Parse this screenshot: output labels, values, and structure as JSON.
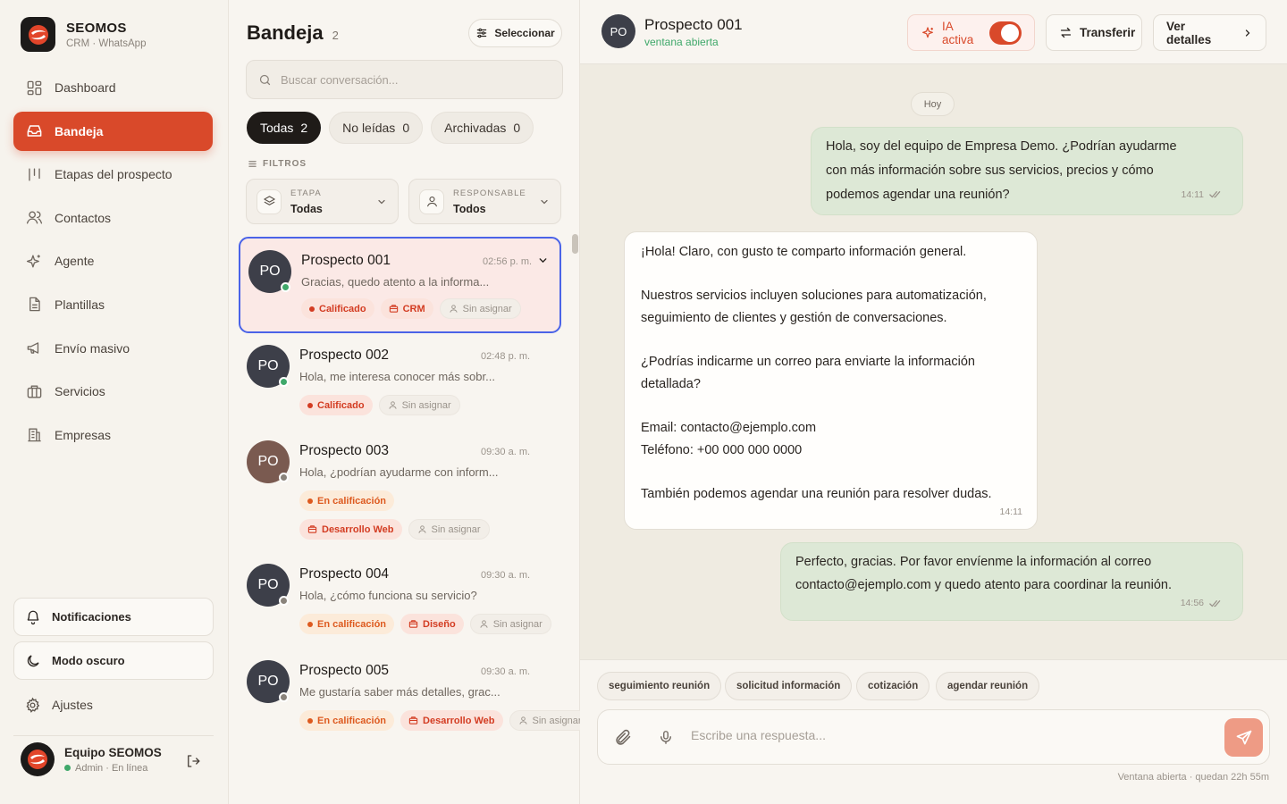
{
  "brand": {
    "name": "SEOMOS",
    "subtitle": "CRM · WhatsApp"
  },
  "nav": [
    {
      "label": "Dashboard",
      "icon": "dashboard-icon",
      "active": false
    },
    {
      "label": "Bandeja",
      "icon": "inbox-icon",
      "active": true
    },
    {
      "label": "Etapas del prospecto",
      "icon": "stages-icon",
      "active": false
    },
    {
      "label": "Contactos",
      "icon": "contacts-icon",
      "active": false
    },
    {
      "label": "Agente",
      "icon": "sparkle-icon",
      "active": false
    },
    {
      "label": "Plantillas",
      "icon": "document-icon",
      "active": false
    },
    {
      "label": "Envío masivo",
      "icon": "megaphone-icon",
      "active": false
    },
    {
      "label": "Servicios",
      "icon": "briefcase-icon",
      "active": false
    },
    {
      "label": "Empresas",
      "icon": "building-icon",
      "active": false
    }
  ],
  "sidebar_bottom": {
    "notifications": "Notificaciones",
    "dark_mode": "Modo oscuro",
    "settings": "Ajustes"
  },
  "profile": {
    "name": "Equipo SEOMOS",
    "role": "Admin · En línea"
  },
  "inbox": {
    "title": "Bandeja",
    "count": "2",
    "select_label": "Seleccionar",
    "search_placeholder": "Buscar conversación...",
    "tabs": [
      {
        "label": "Todas",
        "count": "2",
        "active": true
      },
      {
        "label": "No leídas",
        "count": "0",
        "active": false
      },
      {
        "label": "Archivadas",
        "count": "0",
        "active": false
      }
    ],
    "filters_label": "FILTROS",
    "filters": [
      {
        "key": "ETAPA",
        "value": "Todas"
      },
      {
        "key": "RESPONSABLE",
        "value": "Todos"
      }
    ],
    "conversations": [
      {
        "initials": "PO",
        "name": "Prospecto 001",
        "time": "02:56 p. m.",
        "preview": "Gracias, quedo atento a la informa...",
        "avatar_color": "#3d3f49",
        "status_color": "#3fa86a",
        "selected": true,
        "chips": [
          {
            "label": "Calificado",
            "style": "red",
            "icon": "dot"
          },
          {
            "label": "CRM",
            "style": "pink",
            "icon": "briefcase"
          },
          {
            "label": "Sin asignar",
            "style": "gray",
            "icon": "user"
          }
        ]
      },
      {
        "initials": "PO",
        "name": "Prospecto 002",
        "time": "02:48 p. m.",
        "preview": "Hola, me interesa conocer más sobr...",
        "avatar_color": "#3d3f49",
        "status_color": "#3fa86a",
        "selected": false,
        "chips": [
          {
            "label": "Calificado",
            "style": "red",
            "icon": "dot"
          },
          {
            "label": "Sin asignar",
            "style": "gray",
            "icon": "user"
          }
        ]
      },
      {
        "initials": "PO",
        "name": "Prospecto 003",
        "time": "09:30 a. m.",
        "preview": "Hola, ¿podrían ayudarme con inform...",
        "avatar_color": "#7a5a50",
        "status_color": "#8a837b",
        "selected": false,
        "chips": [
          {
            "label": "En calificación",
            "style": "orange",
            "icon": "dot"
          }
        ],
        "chips2": [
          {
            "label": "Desarrollo Web",
            "style": "pink",
            "icon": "briefcase"
          },
          {
            "label": "Sin asignar",
            "style": "gray",
            "icon": "user"
          }
        ]
      },
      {
        "initials": "PO",
        "name": "Prospecto 004",
        "time": "09:30 a. m.",
        "preview": "Hola, ¿cómo funciona su servicio?",
        "avatar_color": "#3d3f49",
        "status_color": "#8a837b",
        "selected": false,
        "chips": [
          {
            "label": "En calificación",
            "style": "orange",
            "icon": "dot"
          },
          {
            "label": "Diseño",
            "style": "pink",
            "icon": "briefcase"
          },
          {
            "label": "Sin asignar",
            "style": "gray",
            "icon": "user"
          }
        ]
      },
      {
        "initials": "PO",
        "name": "Prospecto 005",
        "time": "09:30 a. m.",
        "preview": "Me gustaría saber más detalles, grac...",
        "avatar_color": "#3d3f49",
        "status_color": "#8a837b",
        "selected": false,
        "chips": [
          {
            "label": "En calificación",
            "style": "orange",
            "icon": "dot"
          },
          {
            "label": "Desarrollo Web",
            "style": "pink",
            "icon": "briefcase"
          },
          {
            "label": "Sin asignar",
            "style": "gray",
            "icon": "user"
          }
        ]
      }
    ]
  },
  "chat": {
    "initials": "PO",
    "name": "Prospecto 001",
    "status": "ventana abierta",
    "ia_label": "IA activa",
    "ia_enabled": true,
    "transfer_label": "Transferir",
    "details_label": "Ver detalles",
    "day_label": "Hoy",
    "messages": [
      {
        "direction": "out",
        "text": "Hola, soy del equipo de Empresa Demo. ¿Podrían ayudarme\ncon más información sobre sus servicios, precios y cómo\npodemos agendar una reunión?",
        "time": "14:11"
      },
      {
        "direction": "in",
        "text": "¡Hola! Claro, con gusto te comparto información general.\n\nNuestros servicios incluyen soluciones para automatización,\nseguimiento de clientes y gestión de conversaciones.\n\n¿Podrías indicarme un correo para enviarte la información\ndetallada?\n\nEmail: contacto@ejemplo.com\nTeléfono: +00 000 000 0000\n\nTambién podemos agendar una reunión para resolver dudas.",
        "time": "14:11"
      },
      {
        "direction": "out",
        "text": "Perfecto, gracias. Por favor envíenme la información al correo\ncontacto@ejemplo.com y quedo atento para coordinar la reunión.",
        "time": "14:56"
      }
    ],
    "quick_replies": [
      "seguimiento reunión",
      "solicitud información",
      "cotización",
      "agendar reunión"
    ],
    "composer_placeholder": "Escribe una respuesta...",
    "window_note": "Ventana abierta · quedan 22h 55m"
  },
  "colors": {
    "accent": "#d9492a",
    "selected_border": "#4a63e8",
    "online": "#3fa86a",
    "outgoing_bubble": "#dde8d6"
  }
}
